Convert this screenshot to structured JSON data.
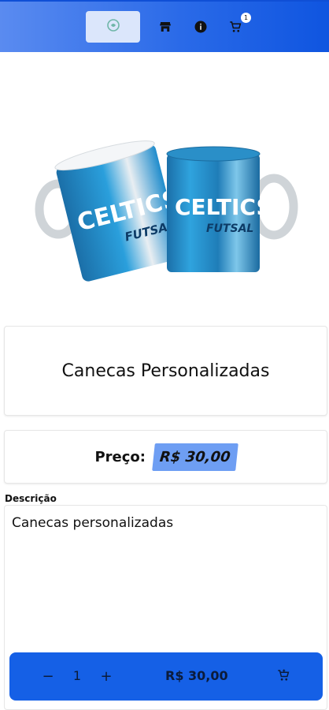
{
  "header": {
    "cart_count": "1",
    "icons": [
      "logo-icon",
      "store-icon",
      "info-icon",
      "cart-icon"
    ]
  },
  "product": {
    "name": "Canecas Personalizadas",
    "image_text_1": "CELTICS",
    "image_text_2": "FUTSAL",
    "price_label": "Preço:",
    "price_value": "R$ 30,00",
    "description_label": "Descrição",
    "description": "Canecas personalizadas"
  },
  "cart_bar": {
    "minus": "−",
    "quantity": "1",
    "plus": "+",
    "total": "R$ 30,00"
  },
  "colors": {
    "topbar": "#2a6ae8",
    "accent": "#1560e6",
    "price_highlight": "#6e9ef3"
  }
}
